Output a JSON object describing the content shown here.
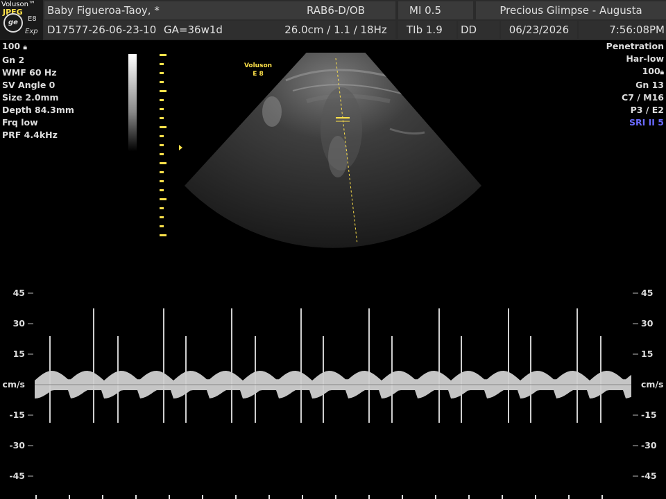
{
  "header": {
    "logo": {
      "brand": "Voluson™",
      "format": "JPEG",
      "model": "E8",
      "mode": "Exp",
      "icon": "ge-logo-icon"
    },
    "patient_name": "Baby Figueroa-Taoy,  *",
    "patient_id": "D17577-26-06-23-10",
    "gestational_age": "GA=36w1d",
    "probe_preset": "RAB6-D/OB",
    "depth_settings": "26.0cm / 1.1 / 18Hz",
    "mi": "MI  0.5",
    "tib": "TIb  1.9",
    "dd": "DD",
    "clinic": "Precious Glimpse - Augusta",
    "date": "06/23/2026",
    "time": "7:56:08PM"
  },
  "left_params": [
    "100",
    "Gn  2",
    "WMF 60 Hz",
    "SV Angle  0",
    "Size  2.0mm",
    "Depth 84.3mm",
    "Frq low",
    "PRF  4.4kHz"
  ],
  "right_params": [
    "Penetration",
    "Har-low",
    "100",
    "Gn  13",
    "C7 / M16",
    "P3 / E2",
    "SRI II 5"
  ],
  "image_tag": {
    "line1": "Voluson",
    "line2": "E 8"
  },
  "colors": {
    "accent_yellow": "#ffe24a",
    "sri_blue": "#6a6aff",
    "header_bg": "#2b2b2b"
  },
  "doppler_scale": {
    "unit": "cm/s",
    "ticks": [
      "45",
      "30",
      "15",
      "cm/s",
      "-15",
      "-30",
      "-45"
    ]
  }
}
